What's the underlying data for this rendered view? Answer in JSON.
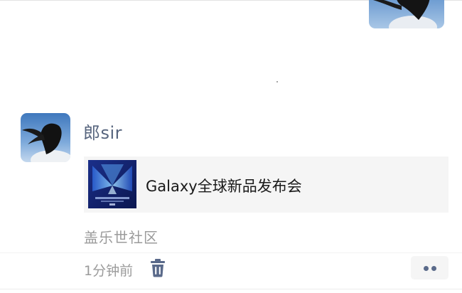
{
  "moment": {
    "author": "郎sir",
    "link_card": {
      "title": "Galaxy全球新品发布会",
      "thumbnail_icon": "samsung-galaxy-unpacked-logo-icon",
      "thumbnail_caption": "Galaxy全球新品发布会"
    },
    "source": "盖乐世社区",
    "time": "1分钟前",
    "delete_icon": "trash-icon",
    "more_icon": "more-dots-icon"
  },
  "colors": {
    "author_name": "#57657e",
    "meta_text": "#9b9b9b",
    "card_background": "#f5f5f5",
    "action_blue": "#5a6a8a"
  }
}
